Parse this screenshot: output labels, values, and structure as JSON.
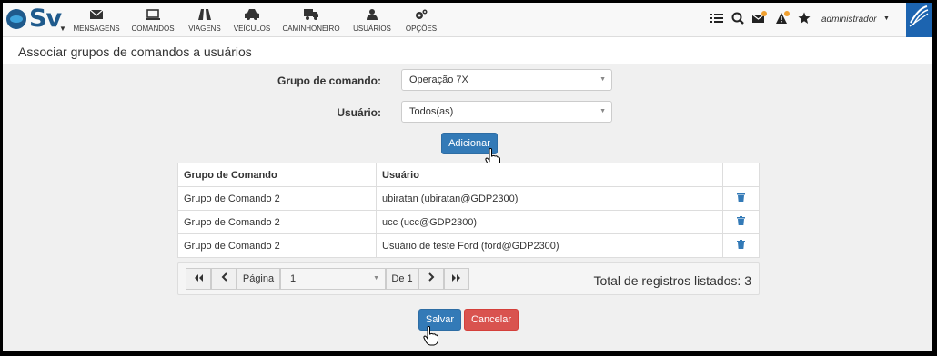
{
  "logo": {
    "text": "Sv"
  },
  "nav": [
    {
      "label": "MENSAGENS",
      "icon": "envelope-icon"
    },
    {
      "label": "COMANDOS",
      "icon": "laptop-icon"
    },
    {
      "label": "VIAGENS",
      "icon": "road-icon"
    },
    {
      "label": "VEÍCULOS",
      "icon": "car-icon"
    },
    {
      "label": "CAMINHONEIRO",
      "icon": "truck-icon"
    },
    {
      "label": "USUÁRIOS",
      "icon": "user-icon"
    },
    {
      "label": "OPÇÕES",
      "icon": "gears-icon"
    }
  ],
  "header": {
    "user": "administrador"
  },
  "page": {
    "title": "Associar grupos de comandos a usuários"
  },
  "form": {
    "group_label": "Grupo de comando:",
    "group_value": "Operação 7X",
    "user_label": "Usuário:",
    "user_value": "Todos(as)",
    "add_label": "Adicionar"
  },
  "table": {
    "headers": [
      "Grupo de Comando",
      "Usuário",
      ""
    ],
    "rows": [
      [
        "Grupo de Comando 2",
        "ubiratan (ubiratan@GDP2300)"
      ],
      [
        "Grupo de Comando 2",
        "ucc (ucc@GDP2300)"
      ],
      [
        "Grupo de Comando 2",
        "Usuário de teste Ford (ford@GDP2300)"
      ]
    ]
  },
  "pager": {
    "page_label": "Página",
    "page_value": "1",
    "of_label": "De 1",
    "total": "Total de registros listados: 3"
  },
  "actions": {
    "save": "Salvar",
    "cancel": "Cancelar"
  },
  "colors": {
    "primary": "#337ab7",
    "danger": "#d9534f",
    "brand": "#1c64b0"
  }
}
